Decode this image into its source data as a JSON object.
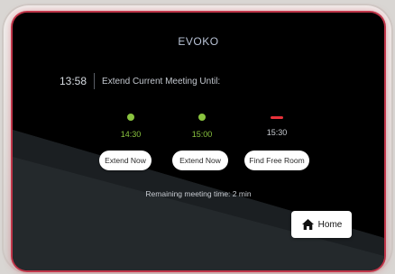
{
  "brand": "EVOKO",
  "header": {
    "clock": "13:58",
    "title": "Extend Current Meeting Until:"
  },
  "options": [
    {
      "time": "14:30",
      "status": "available",
      "color": "#8ac43f"
    },
    {
      "time": "15:00",
      "status": "available",
      "color": "#8ac43f"
    },
    {
      "time": "15:30",
      "status": "unavailable",
      "color": "#e8313a"
    }
  ],
  "buttons": {
    "extend_now_1": "Extend Now",
    "extend_now_2": "Extend Now",
    "find_free_room": "Find Free Room",
    "home": "Home"
  },
  "remaining": "Remaining meeting time: 2 min",
  "colors": {
    "accent_green": "#8ac43f",
    "accent_red": "#e8313a",
    "screen_glow": "#c0364a"
  },
  "icons": {
    "home": "home-icon"
  }
}
